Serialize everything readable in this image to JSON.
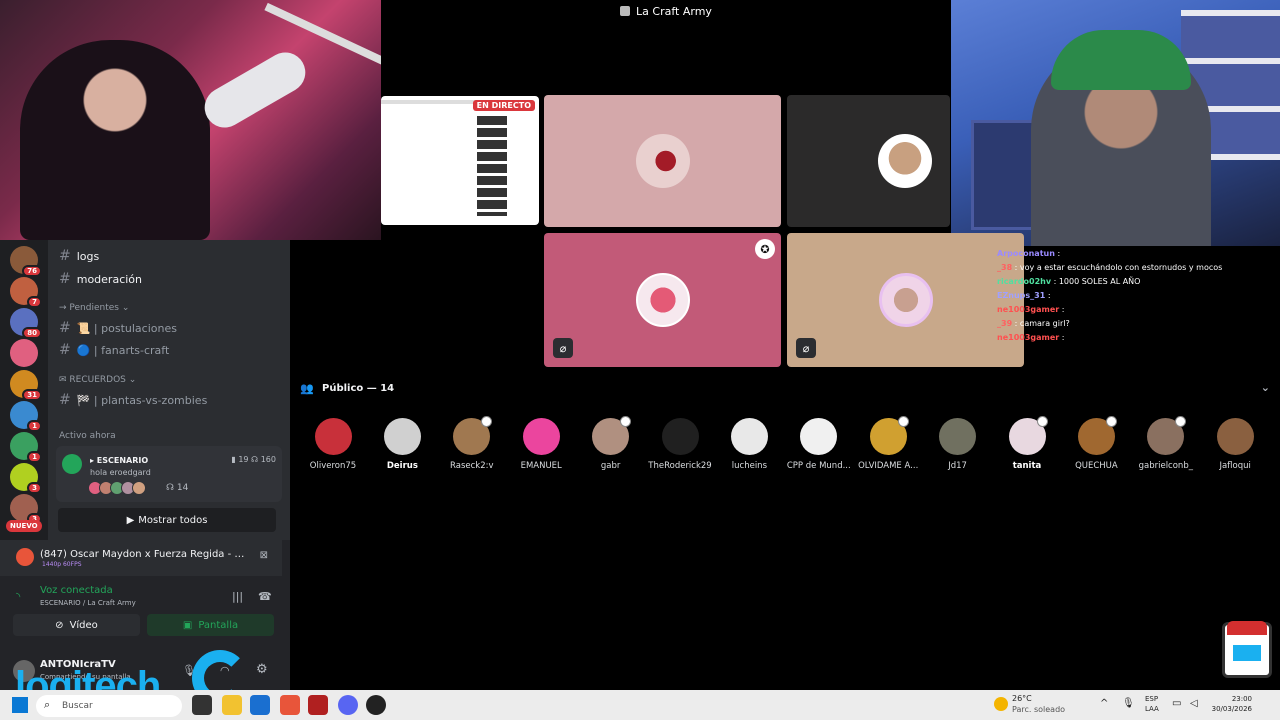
{
  "stage": {
    "title": "La Craft Army",
    "live_badge": "EN DIRECTO"
  },
  "chat": [
    {
      "user": "Arpoconatun",
      "text": ""
    },
    {
      "user": "_38",
      "text": "voy a estar escuchándolo con estornudos y mocos"
    },
    {
      "user": "ricardo02hv",
      "text": "1000 SOLES AL AÑO"
    },
    {
      "user": "EZnups_31",
      "text": ""
    },
    {
      "user": "ne1003gamer",
      "text": ""
    },
    {
      "user": "_39",
      "text": "camara girl?"
    },
    {
      "user": "ne1003gamer",
      "text": ""
    }
  ],
  "guilds": [
    {
      "badge": "76",
      "color": "#8a5a3a"
    },
    {
      "badge": "7",
      "color": "#c06040"
    },
    {
      "badge": "80",
      "color": "#5a70c0"
    },
    {
      "badge": "",
      "color": "#e06080"
    },
    {
      "badge": "31",
      "color": "#d08a20"
    },
    {
      "badge": "1",
      "color": "#3a8ad0"
    },
    {
      "badge": "1",
      "color": "#3aa060"
    },
    {
      "badge": "3",
      "color": "#b0d020"
    },
    {
      "badge": "3",
      "color": "#a06050"
    }
  ],
  "guild_new": "NUEVO",
  "channels": {
    "logs": "logs",
    "moderacion": "moderación",
    "cat_pendientes": "→ Pendientes ⌄",
    "postulaciones": "📜 | postulaciones",
    "fanarts": "🔵 | fanarts-craft",
    "cat_recuerdos": "✉ RECUERDOS ⌄",
    "plantas": "🏁 | plantas-vs-zombies"
  },
  "active_now": {
    "heading": "Activo ahora",
    "stage_name": "▸ ESCENARIO",
    "stage_sub": "hola eroedgard",
    "video_count": "19",
    "listener_total": "160",
    "listener_count": "14",
    "show_all": "Mostrar todos"
  },
  "now_playing": {
    "title": "(847) Oscar Maydon x Fuerza Regida - TU B...",
    "quality": "1440p 60FPS"
  },
  "voice": {
    "status": "Voz conectada",
    "sub": "ESCENARIO / La Craft Army",
    "video_label": "Vídeo",
    "screen_label": "Pantalla"
  },
  "user": {
    "name": "ANTONIcraTV",
    "status": "Compartiendo su pantalla"
  },
  "audience": {
    "heading": "Público — 14",
    "members": [
      {
        "name": "Oliveron75",
        "bold": false,
        "color": "#c8303a",
        "mod": false
      },
      {
        "name": "Deirus",
        "bold": true,
        "color": "#d0d0d0",
        "mod": false
      },
      {
        "name": "Raseck2:v",
        "bold": false,
        "color": "#a07850",
        "mod": true
      },
      {
        "name": "EMANUEL",
        "bold": false,
        "color": "#eb459e",
        "mod": false
      },
      {
        "name": "gabr",
        "bold": false,
        "color": "#b09080",
        "mod": true
      },
      {
        "name": "TheRoderick29",
        "bold": false,
        "color": "#202020",
        "mod": false
      },
      {
        "name": "lucheins",
        "bold": false,
        "color": "#e8e8e8",
        "mod": false
      },
      {
        "name": "CPP de Mund...",
        "bold": false,
        "color": "#f0f0f0",
        "mod": false
      },
      {
        "name": "OLVIDAME A...",
        "bold": false,
        "color": "#d0a030",
        "mod": true
      },
      {
        "name": "Jd17",
        "bold": false,
        "color": "#707060",
        "mod": false
      },
      {
        "name": "tanita",
        "bold": true,
        "color": "#e8d8e0",
        "mod": true
      },
      {
        "name": "QUECHUA",
        "bold": false,
        "color": "#a06830",
        "mod": true
      },
      {
        "name": "gabrielconb_",
        "bold": false,
        "color": "#8a7060",
        "mod": true
      },
      {
        "name": "Jafloqui",
        "bold": false,
        "color": "#8a6040",
        "mod": false
      }
    ]
  },
  "taskbar": {
    "search_placeholder": "Buscar",
    "weather_temp": "26°C",
    "weather_desc": "Parc. soleado",
    "lang1": "ESP",
    "lang2": "LAA",
    "time": "23:00",
    "date": "30/03/2026"
  },
  "logitech": {
    "text": "logitech"
  },
  "colors": {
    "accent_green": "#23a55a",
    "live_red": "#da373c",
    "discord_blurple": "#5865f2"
  }
}
